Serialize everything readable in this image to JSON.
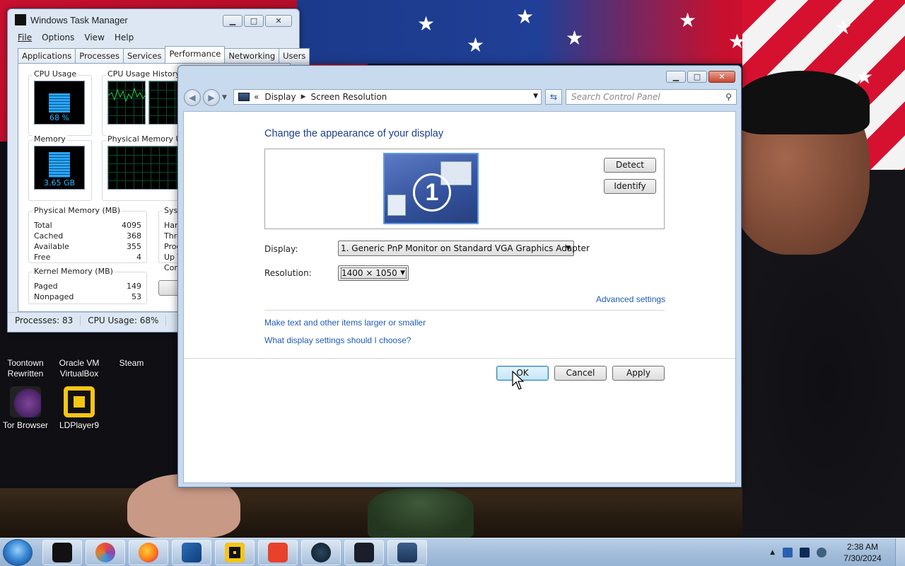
{
  "desktop": {
    "icons": [
      {
        "label": "Toontown\nRewritten",
        "line1": "Toontown",
        "line2": "Rewritten"
      },
      {
        "label": "Oracle VM VirtualBox",
        "line1": "Oracle VM",
        "line2": "VirtualBox"
      },
      {
        "label": "Steam",
        "line1": "Steam",
        "line2": ""
      },
      {
        "label": "Tor Browser",
        "line1": "Tor Browser",
        "line2": ""
      },
      {
        "label": "LDPlayer9",
        "line1": "LDPlayer9",
        "line2": ""
      }
    ]
  },
  "task_manager": {
    "title": "Windows Task Manager",
    "menu": [
      "File",
      "Options",
      "View",
      "Help"
    ],
    "tabs": [
      "Applications",
      "Processes",
      "Services",
      "Performance",
      "Networking",
      "Users"
    ],
    "active_tab": "Performance",
    "cpu_usage_label": "CPU Usage",
    "cpu_usage_value": "68 %",
    "cpu_usage_fraction": 0.68,
    "cpu_history_label": "CPU Usage History",
    "memory_label": "Memory",
    "memory_value": "3.65 GB",
    "memory_fraction": 0.9,
    "phys_history_label": "Physical Memory Usa",
    "physical_memory": {
      "title": "Physical Memory (MB)",
      "rows": [
        {
          "k": "Total",
          "v": "4095"
        },
        {
          "k": "Cached",
          "v": "368"
        },
        {
          "k": "Available",
          "v": "355"
        },
        {
          "k": "Free",
          "v": "4"
        }
      ]
    },
    "system": {
      "title": "Syst",
      "rows": [
        "Han",
        "Thre",
        "Proc",
        "Up T",
        "Com"
      ]
    },
    "kernel_memory": {
      "title": "Kernel Memory (MB)",
      "rows": [
        {
          "k": "Paged",
          "v": "149"
        },
        {
          "k": "Nonpaged",
          "v": "53"
        }
      ]
    },
    "status": {
      "processes": "Processes: 83",
      "cpu": "CPU Usage: 68%"
    }
  },
  "control_panel": {
    "breadcrumb": [
      "Display",
      "Screen Resolution"
    ],
    "breadcrumb_prefix": "«",
    "search_placeholder": "Search Control Panel",
    "heading": "Change the appearance of your display",
    "monitor_number": "1",
    "detect_button": "Detect",
    "identify_button": "Identify",
    "display_label": "Display:",
    "display_value": "1. Generic PnP Monitor on Standard VGA Graphics Adapter",
    "resolution_label": "Resolution:",
    "resolution_value": "1400 × 1050",
    "advanced_link": "Advanced settings",
    "link_text_size": "Make text and other items larger or smaller",
    "link_choose": "What display settings should I choose?",
    "ok_button": "OK",
    "cancel_button": "Cancel",
    "apply_button": "Apply"
  },
  "taskbar": {
    "apps": [
      "unknown-app",
      "tor-browser",
      "firefox",
      "virtualbox",
      "ldplayer",
      "anydesk",
      "steam",
      "terminal-app",
      "display-settings"
    ],
    "clock_time": "2:38 AM",
    "clock_date": "7/30/2024"
  }
}
